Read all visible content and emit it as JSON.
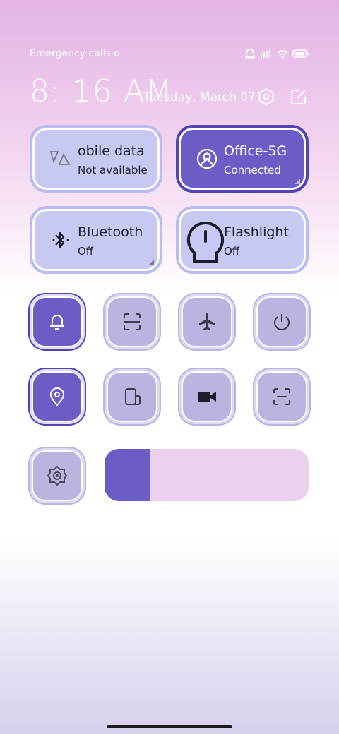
{
  "status_bar": {
    "carrier_text": "Emergency calls o",
    "icons": [
      "alarm-icon",
      "signal-icon",
      "wifi-icon",
      "battery-icon"
    ]
  },
  "header": {
    "time": "8: 16 AM",
    "date": "Tuesday, March 07",
    "settings_icon": "settings-hex-icon",
    "edit_icon": "edit-icon"
  },
  "big_tiles": [
    {
      "title": "obile data",
      "subtitle": "Not available",
      "icon": "mobile-data-icon",
      "active": false
    },
    {
      "title": "Office-5G",
      "subtitle": "Connected",
      "icon": "wifi-icon",
      "active": true
    },
    {
      "title": "Bluetooth",
      "subtitle": "Off",
      "icon": "bluetooth-icon",
      "active": false
    },
    {
      "title": "Flashlight",
      "subtitle": "Off",
      "icon": "flashlight-icon",
      "active": false
    }
  ],
  "small_tiles_row1": [
    {
      "icon": "bell-icon",
      "active": true
    },
    {
      "icon": "scan-icon",
      "active": false
    },
    {
      "icon": "airplane-icon",
      "active": false
    },
    {
      "icon": "power-icon",
      "active": false
    }
  ],
  "small_tiles_row2": [
    {
      "icon": "location-icon",
      "active": true
    },
    {
      "icon": "screen-rotate-icon",
      "active": false
    },
    {
      "icon": "video-camera-icon",
      "active": false
    },
    {
      "icon": "screenshot-icon",
      "active": false
    }
  ],
  "brightness": {
    "icon": "brightness-icon",
    "level": 0.22
  },
  "colors": {
    "accent": "#6a5dc6",
    "tile_off": "#c7c9f3",
    "slider_track": "#ecd1ef"
  }
}
